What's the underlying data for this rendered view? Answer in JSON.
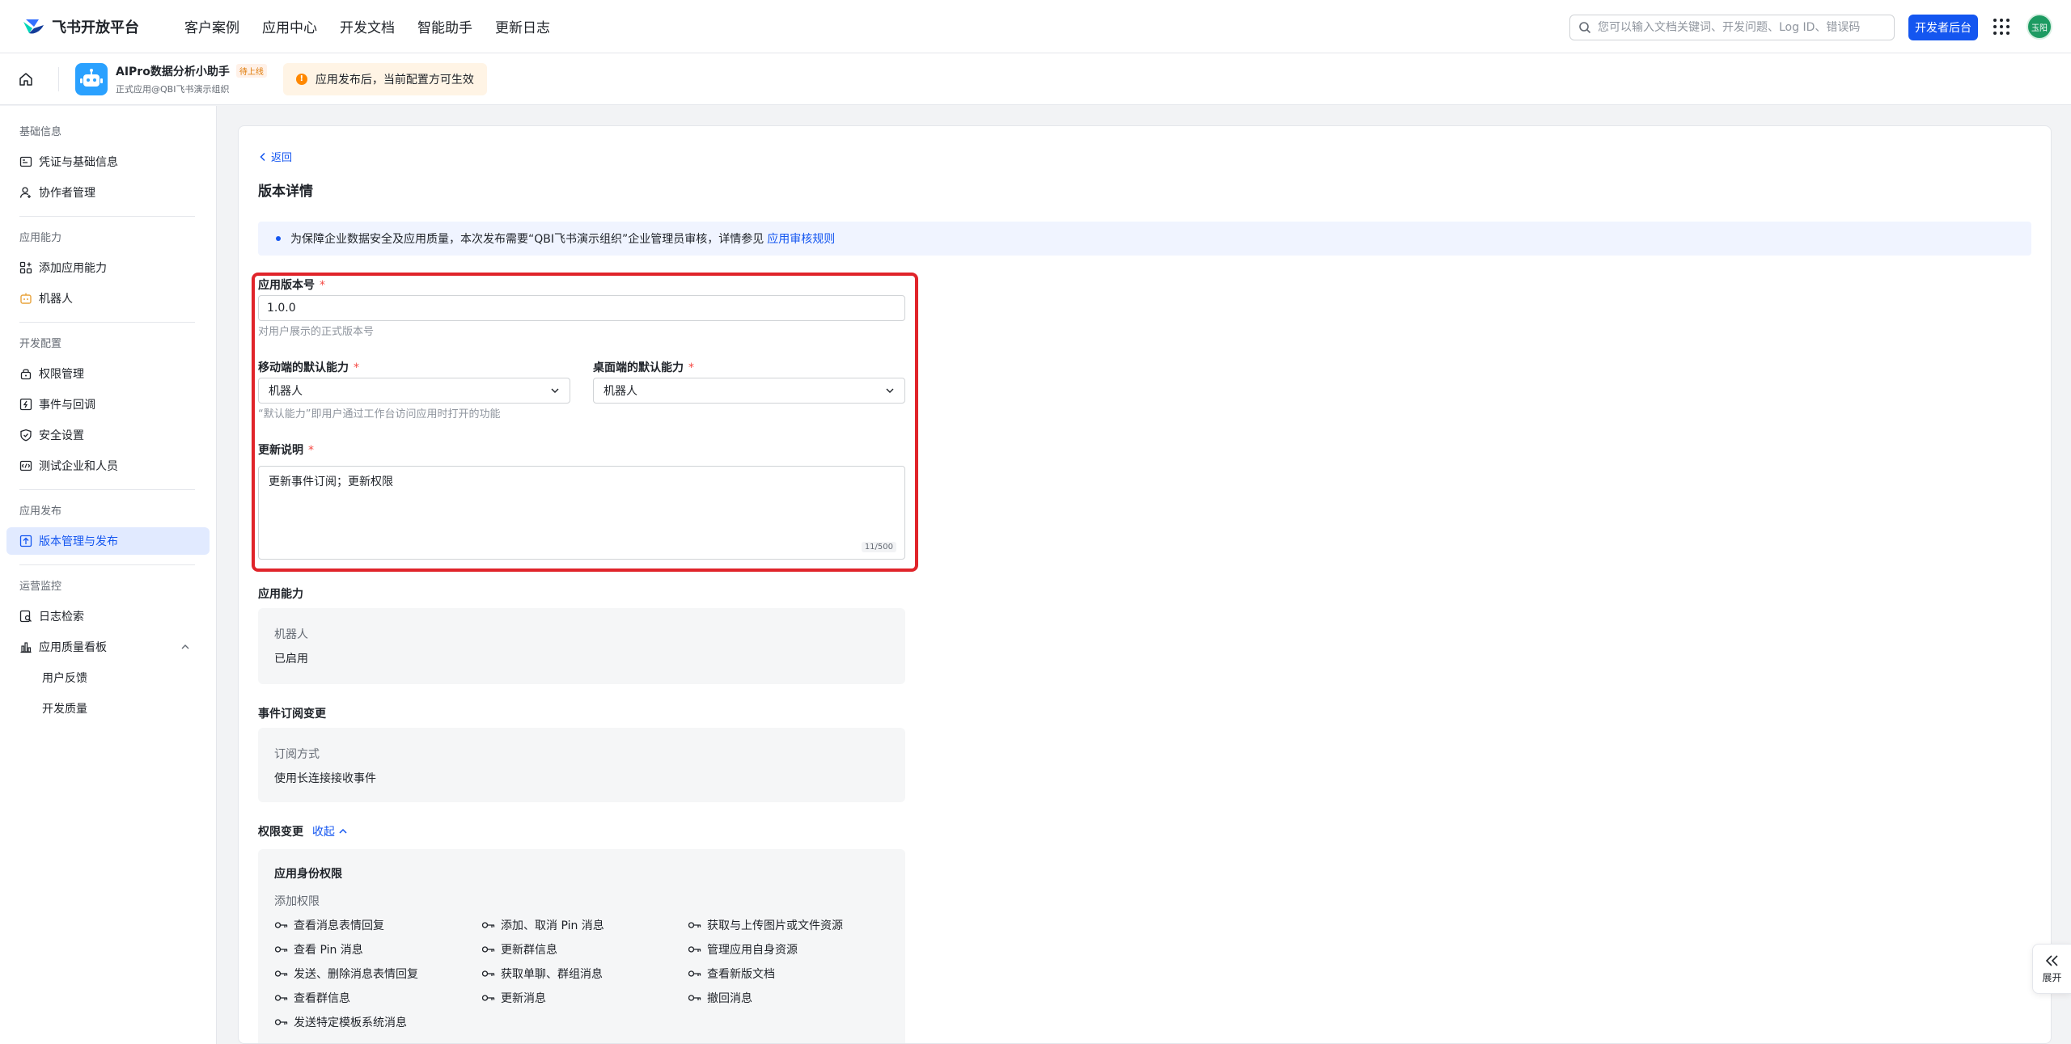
{
  "brand": {
    "name": "飞书开放平台"
  },
  "topnav": {
    "links": [
      "客户案例",
      "应用中心",
      "开发文档",
      "智能助手",
      "更新日志"
    ],
    "search_placeholder": "您可以输入文档关键词、开发问题、Log ID、错误码",
    "dev_console_label": "开发者后台",
    "avatar_text": "玉阳"
  },
  "app": {
    "name": "AIPro数据分析小助手",
    "badge": "待上线",
    "subtitle": "正式应用@QBI飞书演示组织",
    "notice": "应用发布后，当前配置方可生效",
    "notice_icon": "!"
  },
  "sidebar": {
    "groups": [
      {
        "title": "基础信息",
        "items": [
          {
            "label": "凭证与基础信息",
            "icon": "credential-icon"
          },
          {
            "label": "协作者管理",
            "icon": "user-icon"
          }
        ]
      },
      {
        "title": "应用能力",
        "items": [
          {
            "label": "添加应用能力",
            "icon": "add-capability-icon"
          },
          {
            "label": "机器人",
            "icon": "robot-icon"
          }
        ]
      },
      {
        "title": "开发配置",
        "items": [
          {
            "label": "权限管理",
            "icon": "lock-icon"
          },
          {
            "label": "事件与回调",
            "icon": "event-icon"
          },
          {
            "label": "安全设置",
            "icon": "shield-icon"
          },
          {
            "label": "测试企业和人员",
            "icon": "test-icon"
          }
        ]
      },
      {
        "title": "应用发布",
        "items": [
          {
            "label": "版本管理与发布",
            "icon": "upload-icon",
            "active": true
          }
        ]
      },
      {
        "title": "运营监控",
        "items": [
          {
            "label": "日志检索",
            "icon": "log-search-icon"
          },
          {
            "label": "应用质量看板",
            "icon": "bar-chart-icon"
          },
          {
            "label": "用户反馈"
          },
          {
            "label": "开发质量"
          }
        ]
      }
    ]
  },
  "main": {
    "back_label": "返回",
    "title": "版本详情",
    "banner_text": "为保障企业数据安全及应用质量，本次发布需要“QBI飞书演示组织”企业管理员审核，详情参见",
    "banner_link": "应用审核规则",
    "version": {
      "label": "应用版本号",
      "value": "1.0.0",
      "hint": "对用户展示的正式版本号"
    },
    "mobile_default": {
      "label": "移动端的默认能力",
      "value": "机器人"
    },
    "desktop_default": {
      "label": "桌面端的默认能力",
      "value": "机器人"
    },
    "default_hint": "“默认能力”即用户通过工作台访问应用时打开的功能",
    "notes": {
      "label": "更新说明",
      "value": "更新事件订阅；更新权限",
      "counter": "11/500"
    },
    "required_mark": "*",
    "capability": {
      "title": "应用能力",
      "key": "机器人",
      "value": "已启用"
    },
    "event": {
      "title": "事件订阅变更",
      "key": "订阅方式",
      "value": "使用长连接接收事件"
    },
    "permissions": {
      "title": "权限变更",
      "toggle": "收起",
      "box_title": "应用身份权限",
      "sub_title": "添加权限",
      "items": [
        "查看消息表情回复",
        "添加、取消 Pin 消息",
        "获取与上传图片或文件资源",
        "查看 Pin 消息",
        "更新群信息",
        "管理应用自身资源",
        "发送、删除消息表情回复",
        "获取单聊、群组消息",
        "查看新版文档",
        "查看群信息",
        "更新消息",
        "撤回消息",
        "发送特定模板系统消息"
      ]
    }
  },
  "expand_tab": {
    "label": "展开"
  },
  "colors": {
    "primary": "#1456f0",
    "highlight_frame": "#e0242a",
    "required": "#f54a45"
  }
}
